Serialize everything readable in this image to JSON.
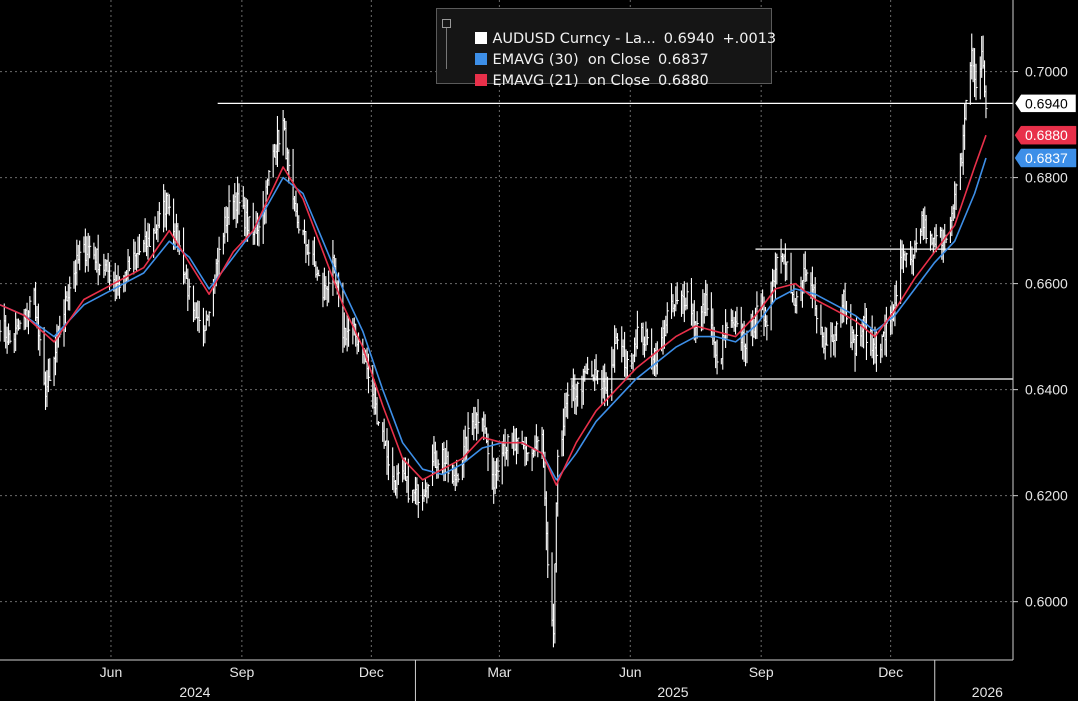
{
  "legend": {
    "rows": [
      {
        "swatch": "#ffffff",
        "label": "AUDUSD Curncy - La...",
        "value": "0.6940",
        "change": "+.0013"
      },
      {
        "swatch": "#3d8fe8",
        "label": "EMAVG (30)  on Close",
        "value": "0.6837"
      },
      {
        "swatch": "#e8304a",
        "label": "EMAVG (21)  on Close",
        "value": "0.6880"
      }
    ]
  },
  "chart_data": {
    "type": "line",
    "title": "",
    "ylim": [
      0.589,
      0.7135
    ],
    "y_ticks": [
      {
        "value": 0.6,
        "label": "0.6000"
      },
      {
        "value": 0.62,
        "label": "0.6200"
      },
      {
        "value": 0.64,
        "label": "0.6400"
      },
      {
        "value": 0.66,
        "label": "0.6600"
      },
      {
        "value": 0.68,
        "label": "0.6800"
      },
      {
        "value": 0.7,
        "label": "0.7000"
      }
    ],
    "x_range": [
      "2024-03-15",
      "2026-02-25"
    ],
    "x_ticks": [
      {
        "date": "2024-06-01",
        "label": "Jun"
      },
      {
        "date": "2024-09-01",
        "label": "Sep"
      },
      {
        "date": "2024-12-01",
        "label": "Dec"
      },
      {
        "date": "2025-03-01",
        "label": "Mar"
      },
      {
        "date": "2025-06-01",
        "label": "Jun"
      },
      {
        "date": "2025-09-01",
        "label": "Sep"
      },
      {
        "date": "2025-12-01",
        "label": "Dec"
      }
    ],
    "year_labels": [
      {
        "date": "2024-07-30",
        "label": "2024"
      },
      {
        "date": "2025-07-01",
        "label": "2025"
      },
      {
        "date": "2026-02-07",
        "label": "2026"
      }
    ],
    "year_separators": [
      "2025-01-01",
      "2026-01-01"
    ],
    "grid": true,
    "legend_position": "top-center",
    "horizontal_lines": [
      {
        "value": 0.694,
        "from": "2024-08-15"
      },
      {
        "value": 0.6665,
        "from": "2025-08-28"
      },
      {
        "value": 0.642,
        "from": "2025-04-20"
      }
    ],
    "value_labels": [
      {
        "value": 0.694,
        "label": "0.6940",
        "color": "#ffffff",
        "text_color": "#000000"
      },
      {
        "value": 0.688,
        "label": "0.6880",
        "color": "#e8304a",
        "text_color": "#ffffff"
      },
      {
        "value": 0.6837,
        "label": "0.6837",
        "color": "#3d8fe8",
        "text_color": "#ffffff"
      }
    ],
    "series": [
      {
        "name": "AUDUSD Curncy",
        "kind": "hilo",
        "color": "#ffffff",
        "points": [
          [
            "2024-03-15",
            0.653
          ],
          [
            "2024-03-22",
            0.649
          ],
          [
            "2024-04-01",
            0.653
          ],
          [
            "2024-04-08",
            0.658
          ],
          [
            "2024-04-15",
            0.64
          ],
          [
            "2024-04-19",
            0.641
          ],
          [
            "2024-04-26",
            0.651
          ],
          [
            "2024-05-03",
            0.66
          ],
          [
            "2024-05-10",
            0.665
          ],
          [
            "2024-05-17",
            0.667
          ],
          [
            "2024-05-24",
            0.664
          ],
          [
            "2024-05-31",
            0.662
          ],
          [
            "2024-06-07",
            0.66
          ],
          [
            "2024-06-14",
            0.663
          ],
          [
            "2024-06-21",
            0.666
          ],
          [
            "2024-06-28",
            0.668
          ],
          [
            "2024-07-05",
            0.672
          ],
          [
            "2024-07-11",
            0.676
          ],
          [
            "2024-07-16",
            0.67
          ],
          [
            "2024-07-23",
            0.662
          ],
          [
            "2024-07-30",
            0.652
          ],
          [
            "2024-08-05",
            0.652
          ],
          [
            "2024-08-12",
            0.66
          ],
          [
            "2024-08-19",
            0.67
          ],
          [
            "2024-08-26",
            0.677
          ],
          [
            "2024-09-02",
            0.673
          ],
          [
            "2024-09-09",
            0.669
          ],
          [
            "2024-09-16",
            0.674
          ],
          [
            "2024-09-23",
            0.685
          ],
          [
            "2024-09-30",
            0.69
          ],
          [
            "2024-10-07",
            0.674
          ],
          [
            "2024-10-14",
            0.669
          ],
          [
            "2024-10-21",
            0.664
          ],
          [
            "2024-10-28",
            0.658
          ],
          [
            "2024-11-04",
            0.663
          ],
          [
            "2024-11-11",
            0.651
          ],
          [
            "2024-11-18",
            0.651
          ],
          [
            "2024-11-25",
            0.648
          ],
          [
            "2024-12-02",
            0.638
          ],
          [
            "2024-12-09",
            0.632
          ],
          [
            "2024-12-16",
            0.623
          ],
          [
            "2024-12-23",
            0.623
          ],
          [
            "2024-12-30",
            0.62
          ],
          [
            "2025-01-06",
            0.621
          ],
          [
            "2025-01-13",
            0.626
          ],
          [
            "2025-01-20",
            0.628
          ],
          [
            "2025-01-27",
            0.622
          ],
          [
            "2025-02-03",
            0.627
          ],
          [
            "2025-02-10",
            0.634
          ],
          [
            "2025-02-17",
            0.636
          ],
          [
            "2025-02-24",
            0.622
          ],
          [
            "2025-03-03",
            0.63
          ],
          [
            "2025-03-10",
            0.629
          ],
          [
            "2025-03-17",
            0.629
          ],
          [
            "2025-03-24",
            0.628
          ],
          [
            "2025-03-31",
            0.631
          ],
          [
            "2025-04-04",
            0.605
          ],
          [
            "2025-04-08",
            0.594
          ],
          [
            "2025-04-11",
            0.628
          ],
          [
            "2025-04-18",
            0.638
          ],
          [
            "2025-04-25",
            0.64
          ],
          [
            "2025-05-02",
            0.643
          ],
          [
            "2025-05-09",
            0.642
          ],
          [
            "2025-05-16",
            0.64
          ],
          [
            "2025-05-23",
            0.65
          ],
          [
            "2025-05-30",
            0.644
          ],
          [
            "2025-06-06",
            0.651
          ],
          [
            "2025-06-13",
            0.649
          ],
          [
            "2025-06-20",
            0.646
          ],
          [
            "2025-06-27",
            0.654
          ],
          [
            "2025-07-04",
            0.656
          ],
          [
            "2025-07-11",
            0.658
          ],
          [
            "2025-07-18",
            0.652
          ],
          [
            "2025-07-25",
            0.657
          ],
          [
            "2025-08-01",
            0.644
          ],
          [
            "2025-08-08",
            0.652
          ],
          [
            "2025-08-15",
            0.651
          ],
          [
            "2025-08-22",
            0.649
          ],
          [
            "2025-08-29",
            0.654
          ],
          [
            "2025-09-05",
            0.654
          ],
          [
            "2025-09-12",
            0.665
          ],
          [
            "2025-09-17",
            0.667
          ],
          [
            "2025-09-24",
            0.655
          ],
          [
            "2025-10-01",
            0.661
          ],
          [
            "2025-10-08",
            0.658
          ],
          [
            "2025-10-15",
            0.648
          ],
          [
            "2025-10-22",
            0.651
          ],
          [
            "2025-10-29",
            0.658
          ],
          [
            "2025-11-05",
            0.648
          ],
          [
            "2025-11-12",
            0.652
          ],
          [
            "2025-11-19",
            0.648
          ],
          [
            "2025-11-25",
            0.649
          ],
          [
            "2025-12-02",
            0.654
          ],
          [
            "2025-12-09",
            0.665
          ],
          [
            "2025-12-16",
            0.663
          ],
          [
            "2025-12-23",
            0.672
          ],
          [
            "2025-12-30",
            0.667
          ],
          [
            "2026-01-06",
            0.669
          ],
          [
            "2026-01-13",
            0.672
          ],
          [
            "2026-01-20",
            0.684
          ],
          [
            "2026-01-23",
            0.695
          ],
          [
            "2026-01-27",
            0.703
          ],
          [
            "2026-01-30",
            0.697
          ],
          [
            "2026-02-03",
            0.703
          ],
          [
            "2026-02-06",
            0.694
          ]
        ]
      },
      {
        "name": "EMAVG (30)",
        "kind": "line",
        "color": "#3d8fe8",
        "points": [
          [
            "2024-03-15",
            0.656
          ],
          [
            "2024-04-01",
            0.654
          ],
          [
            "2024-04-22",
            0.65
          ],
          [
            "2024-05-13",
            0.656
          ],
          [
            "2024-06-03",
            0.659
          ],
          [
            "2024-06-24",
            0.662
          ],
          [
            "2024-07-12",
            0.668
          ],
          [
            "2024-07-26",
            0.665
          ],
          [
            "2024-08-09",
            0.659
          ],
          [
            "2024-08-26",
            0.665
          ],
          [
            "2024-09-09",
            0.67
          ],
          [
            "2024-09-30",
            0.68
          ],
          [
            "2024-10-14",
            0.677
          ],
          [
            "2024-10-28",
            0.668
          ],
          [
            "2024-11-11",
            0.659
          ],
          [
            "2024-11-25",
            0.651
          ],
          [
            "2024-12-09",
            0.64
          ],
          [
            "2024-12-23",
            0.63
          ],
          [
            "2025-01-06",
            0.625
          ],
          [
            "2025-01-20",
            0.624
          ],
          [
            "2025-02-03",
            0.626
          ],
          [
            "2025-02-17",
            0.629
          ],
          [
            "2025-03-03",
            0.63
          ],
          [
            "2025-03-17",
            0.63
          ],
          [
            "2025-03-31",
            0.628
          ],
          [
            "2025-04-10",
            0.623
          ],
          [
            "2025-04-24",
            0.628
          ],
          [
            "2025-05-08",
            0.634
          ],
          [
            "2025-05-22",
            0.638
          ],
          [
            "2025-06-05",
            0.642
          ],
          [
            "2025-06-19",
            0.645
          ],
          [
            "2025-07-03",
            0.648
          ],
          [
            "2025-07-17",
            0.65
          ],
          [
            "2025-07-31",
            0.65
          ],
          [
            "2025-08-14",
            0.649
          ],
          [
            "2025-08-28",
            0.652
          ],
          [
            "2025-09-11",
            0.657
          ],
          [
            "2025-09-25",
            0.659
          ],
          [
            "2025-10-09",
            0.658
          ],
          [
            "2025-10-23",
            0.656
          ],
          [
            "2025-11-06",
            0.654
          ],
          [
            "2025-11-20",
            0.651
          ],
          [
            "2025-12-04",
            0.654
          ],
          [
            "2025-12-18",
            0.659
          ],
          [
            "2026-01-01",
            0.664
          ],
          [
            "2026-01-15",
            0.668
          ],
          [
            "2026-01-29",
            0.677
          ],
          [
            "2026-02-06",
            0.6837
          ]
        ]
      },
      {
        "name": "EMAVG (21)",
        "kind": "line",
        "color": "#e8304a",
        "points": [
          [
            "2024-03-15",
            0.656
          ],
          [
            "2024-04-01",
            0.654
          ],
          [
            "2024-04-22",
            0.649
          ],
          [
            "2024-05-13",
            0.657
          ],
          [
            "2024-06-03",
            0.66
          ],
          [
            "2024-06-24",
            0.663
          ],
          [
            "2024-07-12",
            0.67
          ],
          [
            "2024-07-26",
            0.664
          ],
          [
            "2024-08-09",
            0.658
          ],
          [
            "2024-08-26",
            0.666
          ],
          [
            "2024-09-09",
            0.67
          ],
          [
            "2024-09-30",
            0.682
          ],
          [
            "2024-10-14",
            0.676
          ],
          [
            "2024-10-28",
            0.666
          ],
          [
            "2024-11-11",
            0.656
          ],
          [
            "2024-11-25",
            0.648
          ],
          [
            "2024-12-09",
            0.637
          ],
          [
            "2024-12-23",
            0.627
          ],
          [
            "2025-01-06",
            0.623
          ],
          [
            "2025-01-20",
            0.625
          ],
          [
            "2025-02-03",
            0.627
          ],
          [
            "2025-02-17",
            0.631
          ],
          [
            "2025-03-03",
            0.63
          ],
          [
            "2025-03-17",
            0.63
          ],
          [
            "2025-03-31",
            0.628
          ],
          [
            "2025-04-10",
            0.622
          ],
          [
            "2025-04-24",
            0.63
          ],
          [
            "2025-05-08",
            0.636
          ],
          [
            "2025-05-22",
            0.64
          ],
          [
            "2025-06-05",
            0.644
          ],
          [
            "2025-06-19",
            0.647
          ],
          [
            "2025-07-03",
            0.65
          ],
          [
            "2025-07-17",
            0.652
          ],
          [
            "2025-07-31",
            0.651
          ],
          [
            "2025-08-14",
            0.65
          ],
          [
            "2025-08-28",
            0.654
          ],
          [
            "2025-09-11",
            0.659
          ],
          [
            "2025-09-25",
            0.66
          ],
          [
            "2025-10-09",
            0.657
          ],
          [
            "2025-10-23",
            0.655
          ],
          [
            "2025-11-06",
            0.653
          ],
          [
            "2025-11-20",
            0.65
          ],
          [
            "2025-12-04",
            0.655
          ],
          [
            "2025-12-18",
            0.661
          ],
          [
            "2026-01-01",
            0.666
          ],
          [
            "2026-01-15",
            0.671
          ],
          [
            "2026-01-29",
            0.682
          ],
          [
            "2026-02-06",
            0.688
          ]
        ]
      }
    ]
  }
}
